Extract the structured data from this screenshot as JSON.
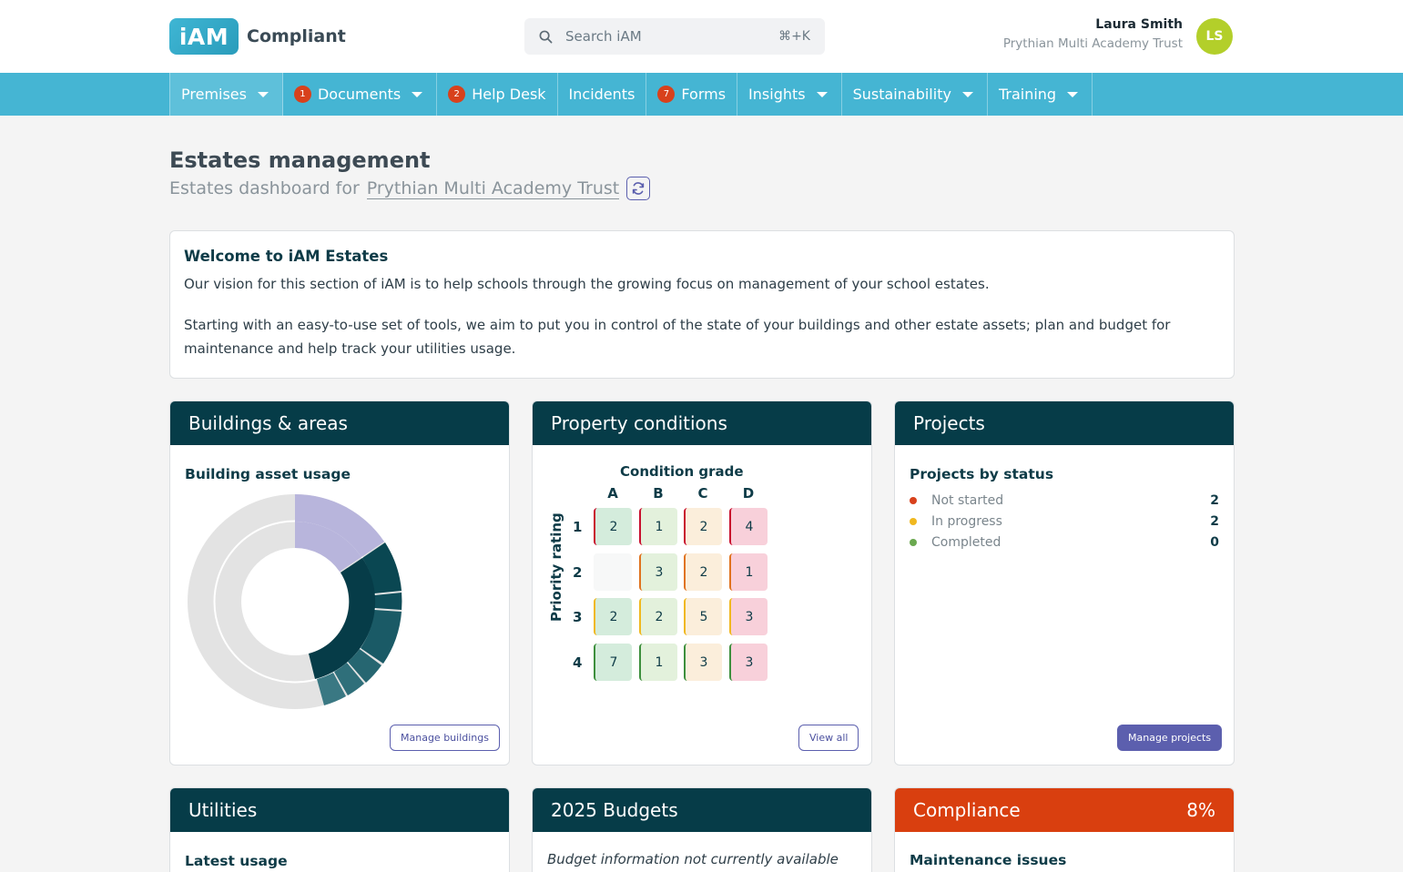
{
  "header": {
    "logo_mark": "iAM",
    "logo_text": "Compliant",
    "search_placeholder": "Search iAM",
    "search_shortcut": "⌘+K",
    "user_name": "Laura Smith",
    "user_org": "Prythian Multi Academy Trust",
    "avatar_initials": "LS"
  },
  "nav": {
    "items": [
      {
        "label": "Premises",
        "badge": "",
        "dropdown": true
      },
      {
        "label": "Documents",
        "badge": "1",
        "dropdown": true
      },
      {
        "label": "Help Desk",
        "badge": "2",
        "dropdown": false
      },
      {
        "label": "Incidents",
        "badge": "",
        "dropdown": false
      },
      {
        "label": "Forms",
        "badge": "7",
        "dropdown": false
      },
      {
        "label": "Insights",
        "badge": "",
        "dropdown": true
      },
      {
        "label": "Sustainability",
        "badge": "",
        "dropdown": true
      },
      {
        "label": "Training",
        "badge": "",
        "dropdown": true
      }
    ]
  },
  "page": {
    "title": "Estates management",
    "subtitle_prefix": "Estates dashboard for",
    "subtitle_org": "Prythian Multi Academy Trust"
  },
  "welcome": {
    "title": "Welcome to iAM Estates",
    "p1": "Our vision for this section of iAM is to help schools through the growing focus on management of your school estates.",
    "p2": "Starting with an easy-to-use set of tools, we aim to put you in control of the state of your buildings and other estate assets; plan and budget for maintenance and help track your utilities usage."
  },
  "buildings": {
    "title": "Buildings & areas",
    "subtitle": "Building asset usage",
    "button": "Manage buildings"
  },
  "property": {
    "title": "Property conditions",
    "grade_label": "Condition grade",
    "priority_label": "Priority rating",
    "columns": [
      "A",
      "B",
      "C",
      "D"
    ],
    "rows": [
      "1",
      "2",
      "3",
      "4"
    ],
    "cells": [
      [
        "2",
        "1",
        "2",
        "4"
      ],
      [
        "",
        "3",
        "2",
        "1"
      ],
      [
        "2",
        "2",
        "5",
        "3"
      ],
      [
        "7",
        "1",
        "3",
        "3"
      ]
    ],
    "button": "View all"
  },
  "projects": {
    "title": "Projects",
    "subtitle": "Projects by status",
    "statuses": [
      {
        "label": "Not started",
        "count": "2",
        "color": "#d8411c"
      },
      {
        "label": "In progress",
        "count": "2",
        "color": "#f0b81f"
      },
      {
        "label": "Completed",
        "count": "0",
        "color": "#6aa84f"
      }
    ],
    "button": "Manage projects"
  },
  "utilities": {
    "title": "Utilities",
    "subtitle": "Latest usage"
  },
  "budgets": {
    "title": "2025 Budgets",
    "message": "Budget information not currently available"
  },
  "compliance": {
    "title": "Compliance",
    "percent": "8%",
    "subtitle": "Maintenance issues"
  },
  "colors": {
    "brand": "#45b5d3",
    "card_header": "#063c48",
    "accent": "#5c5fae",
    "compliance": "#d93f0f"
  }
}
